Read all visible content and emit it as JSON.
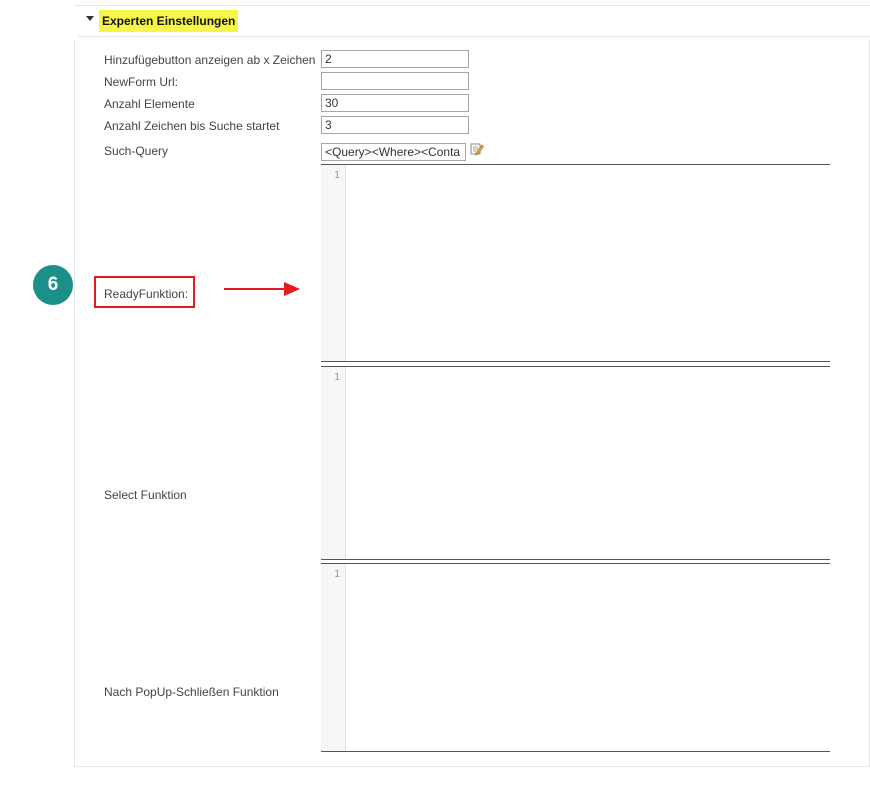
{
  "section": {
    "title": "Experten Einstellungen"
  },
  "fields": {
    "add_button_threshold": {
      "label": "Hinzufügebutton anzeigen ab x Zeichen",
      "value": "2"
    },
    "newform_url": {
      "label": "NewForm Url:",
      "value": ""
    },
    "element_count": {
      "label": "Anzahl Elemente",
      "value": "30"
    },
    "search_start_chars": {
      "label": "Anzahl Zeichen bis Suche startet",
      "value": "3"
    },
    "search_query": {
      "label": "Such-Query",
      "value": "<Query><Where><Conta"
    }
  },
  "editors": {
    "ready_function": {
      "label": "ReadyFunktion:",
      "line": "1"
    },
    "select_function": {
      "label": "Select Funktion",
      "line": "1"
    },
    "after_popup_close": {
      "label": "Nach PopUp-Schließen Funktion",
      "line": "1"
    }
  },
  "annotation": {
    "step_number": "6",
    "accent_color": "#e21b1b",
    "badge_color": "#1a9088"
  },
  "icons": {
    "toggle": "caret-down-icon",
    "edit": "edit-pencil-icon"
  }
}
